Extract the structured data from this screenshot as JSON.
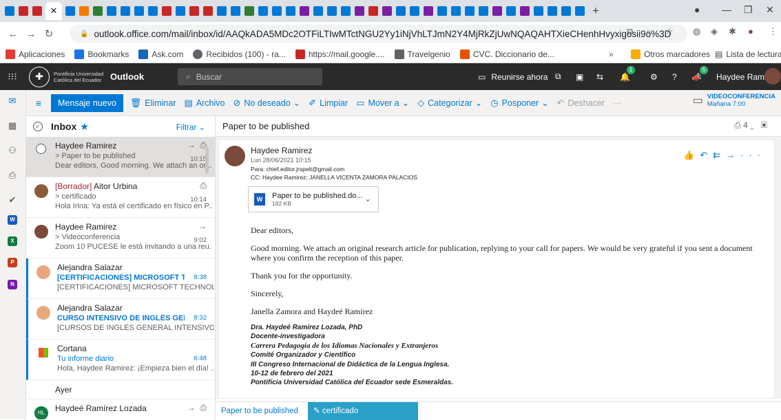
{
  "browser": {
    "url": "outlook.office.com/mail/inbox/id/AAQkADA5MDc2OTFiLTIwMTctNGU2Yy1iNjVhLTJmN2Y4MjRkZjUwNQAQAHTXieCHenhHvyxigosii9o%3D"
  },
  "bookmarks": {
    "items": [
      {
        "label": "Aplicaciones",
        "color": "#e53935"
      },
      {
        "label": "Bookmarks",
        "color": "#1a73e8"
      },
      {
        "label": "Ask.com",
        "color": "#1565c0"
      },
      {
        "label": "Recibidos (100) - ra...",
        "color": "#5f6368"
      },
      {
        "label": "https://mail.google....",
        "color": "#c62828"
      },
      {
        "label": "Travelgenio",
        "color": "#5f6368"
      },
      {
        "label": "CVC. Diccionario de...",
        "color": "#e65100"
      }
    ],
    "more": "»",
    "other": "Otros marcadores",
    "reading_list": "Lista de lectura"
  },
  "header": {
    "org_line1": "Pontificia Universidad",
    "org_line2": "Católica del Ecuador",
    "app": "Outlook",
    "search_placeholder": "Buscar",
    "meet_now": "Reunirse ahora",
    "user": "Haydee Ramirez",
    "badge_a": "1",
    "badge_b": "5"
  },
  "commands": {
    "new_message": "Mensaje nuevo",
    "delete": "Eliminar",
    "archive": "Archivo",
    "junk": "No deseado",
    "sweep": "Limpiar",
    "move": "Mover a",
    "categorize": "Categorizar",
    "snooze": "Posponer",
    "undo": "Deshacer",
    "more": "···",
    "event_title": "VIDEOCONFERENCIA",
    "event_time": "Mañana 7:00"
  },
  "list": {
    "folder": "Inbox",
    "filter": "Filtrar",
    "group_yesterday": "Ayer",
    "messages": [
      {
        "sender": "Haydee Ramirez",
        "subject": "> Paper to be published",
        "time": "10:15",
        "preview": "Dear editors, Good morning. We attach an ori..."
      },
      {
        "draft": "[Borrador]",
        "sender": " Aitor Urbina",
        "subject": "> certificado",
        "time": "10:14",
        "preview": "Hola Irina: Ya está el certificado en físico en P..."
      },
      {
        "sender": "Haydee Ramirez",
        "subject": "> Videoconferencia",
        "time": "9:02",
        "preview": "Zoom 10 PUCESE le está invitando a una reu..."
      },
      {
        "sender": "Alejandra Salazar",
        "subject": "[CERTIFICACIONES] MICROSOFT TEC...",
        "time": "8:38",
        "preview": "[CERTIFICACIONES] MICROSOFT TECHNOLO..."
      },
      {
        "sender": "Alejandra Salazar",
        "subject": "CURSO INTENSIVO DE INGLÉS GENER...",
        "time": "8:32",
        "preview": "[CURSOS DE INGLÉS GENERAL INTENSIVOS] I..."
      },
      {
        "sender": "Cortana",
        "subject": "Tu informe diario",
        "time": "6:48",
        "preview": "Hola, Haydee Ramirez: ¡Empieza bien el día! ..."
      },
      {
        "sender": "Haydeé Ramírez Lozada",
        "avatar": "HL"
      }
    ]
  },
  "reading": {
    "title": "Paper to be published",
    "count": "4",
    "from": "Haydee Ramirez",
    "date": "Lun 28/06/2021 10:15",
    "to": "Para: chief.editor.jrspelt@gmail.com",
    "cc": "CC: Haydee Ramirez; JANELLA VICENTA ZAMORA PALACIOS",
    "attachment_name": "Paper to be published.do...",
    "attachment_size": "182 KB",
    "greeting": "Dear editors,",
    "para1": "Good morning. We attach an original research article for publication, replying to your call for  papers. We would be very grateful if you sent a document where you confirm the reception of this paper.",
    "para2": "Thank you for the opportunity.",
    "closing": "Sincerely,",
    "names": " Janella Zamora and  Haydeé Ramírez",
    "sig1": "Dra. Haydeé Ramírez Lozada, PhD",
    "sig2": "Docente-investigadora",
    "sig3": "Carrera Pedagogía de los Idiomas Nacionales y Extranjeros",
    "sig4": "Comité Organizador y Científico",
    "sig5": "III Congreso Internacional de Didáctica de la Lengua Inglesa.",
    "sig6": "10-12 de febrero del 2021",
    "sig7": "Pontificia Universidad Católica del Ecuador sede Esmeraldas."
  },
  "bottom_tabs": {
    "tab1": "Paper to be published",
    "tab2": "certificado"
  }
}
